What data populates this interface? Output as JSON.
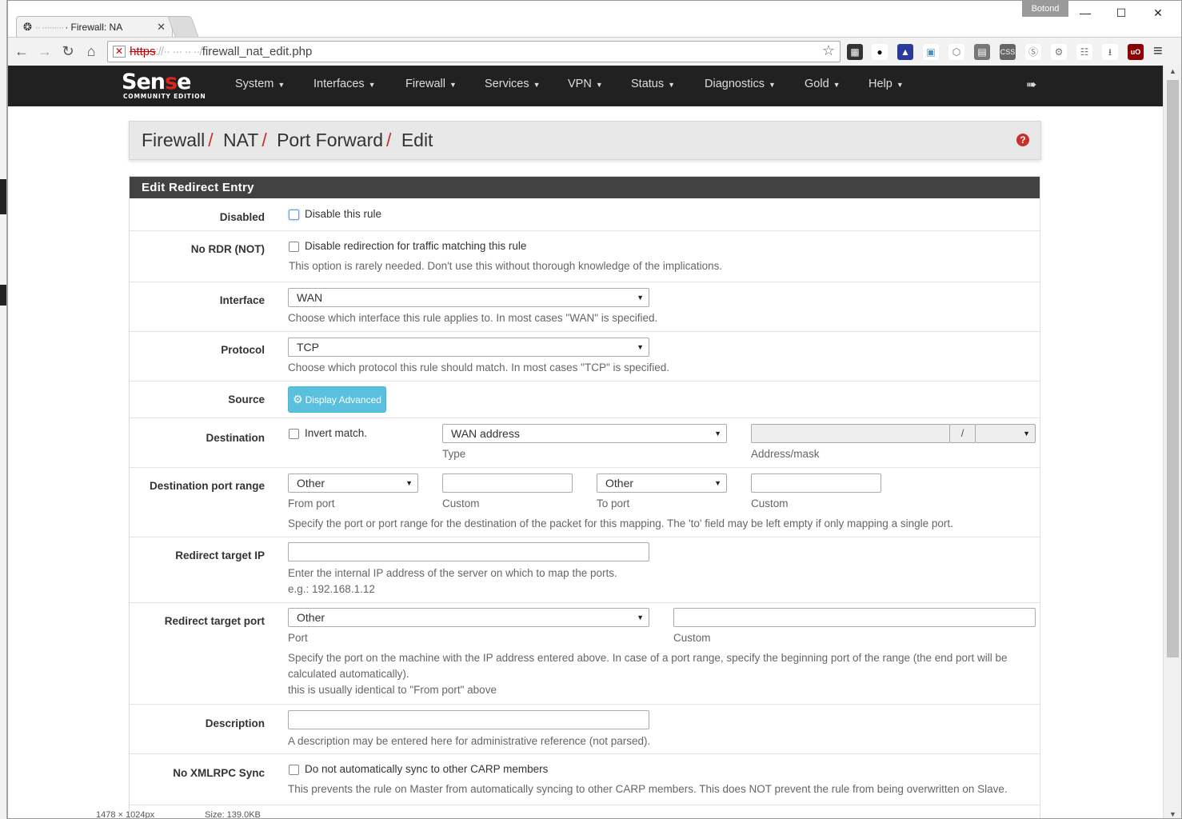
{
  "window": {
    "tab_title": "· Firewall: NA",
    "tab_host_blur": "·· ·········",
    "user": "Botond",
    "url_scheme": "https",
    "url_host_blur": "://·· ··· ·· ··/",
    "url_path": "firewall_nat_edit.php"
  },
  "logo": {
    "brand_a": "Sen",
    "brand_b": "s",
    "brand_c": "e",
    "edition": "COMMUNITY EDITION"
  },
  "nav": {
    "items": [
      "System",
      "Interfaces",
      "Firewall",
      "Services",
      "VPN",
      "Status",
      "Diagnostics",
      "Gold",
      "Help"
    ]
  },
  "breadcrumb": [
    "Firewall",
    "NAT",
    "Port Forward",
    "Edit"
  ],
  "panel": {
    "title": "Edit Redirect Entry"
  },
  "form": {
    "disabled": {
      "label": "Disabled",
      "text": "Disable this rule"
    },
    "nordr": {
      "label": "No RDR (NOT)",
      "text": "Disable redirection for traffic matching this rule",
      "help": "This option is rarely needed. Don't use this without thorough knowledge of the implications."
    },
    "interface": {
      "label": "Interface",
      "value": "WAN",
      "help": "Choose which interface this rule applies to. In most cases \"WAN\" is specified."
    },
    "protocol": {
      "label": "Protocol",
      "value": "TCP",
      "help": "Choose which protocol this rule should match. In most cases \"TCP\" is specified."
    },
    "source": {
      "label": "Source",
      "button": "Display Advanced"
    },
    "destination": {
      "label": "Destination",
      "invert": "Invert match.",
      "type_value": "WAN address",
      "type_label": "Type",
      "slash": "/",
      "addr_label": "Address/mask"
    },
    "dstport": {
      "label": "Destination port range",
      "from_value": "Other",
      "from_label": "From port",
      "custom_label": "Custom",
      "to_value": "Other",
      "to_label": "To port",
      "custom2_label": "Custom",
      "help": "Specify the port or port range for the destination of the packet for this mapping. The 'to' field may be left empty if only mapping a single port."
    },
    "targetip": {
      "label": "Redirect target IP",
      "help1": "Enter the internal IP address of the server on which to map the ports.",
      "help2": "e.g.: 192.168.1.12"
    },
    "targetport": {
      "label": "Redirect target port",
      "value": "Other",
      "port_label": "Port",
      "custom_label": "Custom",
      "help1": "Specify the port on the machine with the IP address entered above. In case of a port range, specify the beginning port of the range (the end port will be",
      "help2": "calculated automatically).",
      "help3": "this is usually identical to \"From port\" above"
    },
    "description": {
      "label": "Description",
      "help": "A description may be entered here for administrative reference (not parsed)."
    },
    "xmlrpc": {
      "label": "No XMLRPC Sync",
      "text": "Do not automatically sync to other CARP members",
      "help": "This prevents the rule on Master from automatically syncing to other CARP members. This does NOT prevent the rule from being overwritten on Slave."
    }
  },
  "statusbar": {
    "dims": "1478 × 1024px",
    "size": "Size: 139.0KB"
  },
  "colors": {
    "navbar": "#212121",
    "accent_red": "#c9302c",
    "panel_head": "#424242",
    "info_button": "#5bc0de"
  }
}
